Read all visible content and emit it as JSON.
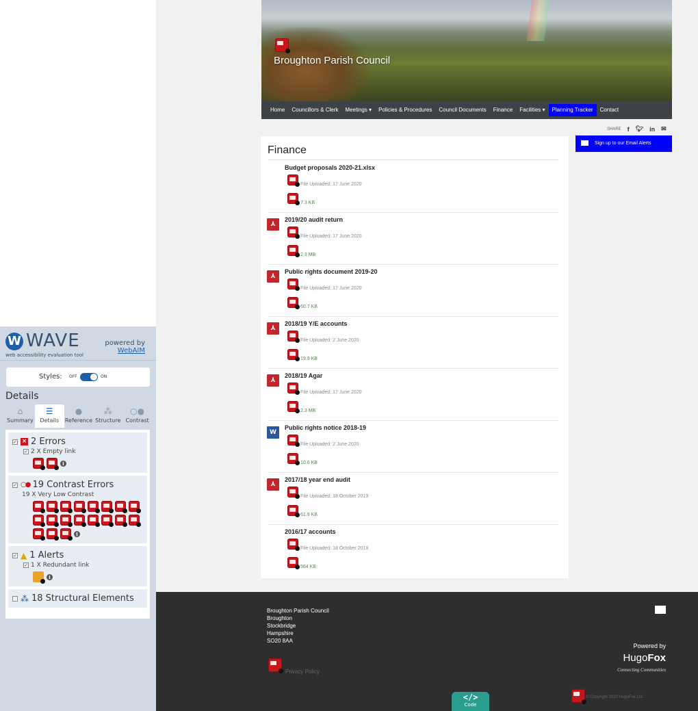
{
  "wave": {
    "logo": "WAVE",
    "logo_mark": "W",
    "tagline": "web accessibility evaluation tool",
    "powered_by": "powered by",
    "powered_link": "WebAIM",
    "styles_label": "Styles:",
    "styles_off": "OFF",
    "styles_on": "ON",
    "panel_title": "Details",
    "tabs": [
      {
        "label": "Summary",
        "icon": "home-icon"
      },
      {
        "label": "Details",
        "icon": "list-icon"
      },
      {
        "label": "Reference",
        "icon": "info-icon"
      },
      {
        "label": "Structure",
        "icon": "structure-icon"
      },
      {
        "label": "Contrast",
        "icon": "contrast-icon"
      }
    ],
    "errors": {
      "title": "2 Errors",
      "sub": "2 X Empty link",
      "count": 2
    },
    "contrast": {
      "title": "19 Contrast Errors",
      "sub": "19 X Very Low Contrast",
      "count": 19
    },
    "alerts": {
      "title": "1 Alerts",
      "sub": "1 X Redundant link",
      "count": 1
    },
    "structural": {
      "title": "18 Structural Elements"
    }
  },
  "site": {
    "title": "Broughton Parish Council",
    "nav": [
      "Home",
      "Councillors & Clerk",
      "Meetings ▾",
      "Policies & Procedures",
      "Council Documents",
      "Finance",
      "Facilities ▾",
      "Planning Tracker",
      "Contact"
    ],
    "share_label": "SHARE",
    "share_icons": [
      "f",
      "t",
      "in",
      "✉"
    ],
    "signup": "Sign up to our Email Alerts",
    "page_title": "Finance",
    "documents": [
      {
        "name": "Budget proposals 2020-21.xlsx",
        "uploaded": "File Uploaded: 17 June 2020",
        "size": "7.3 KB",
        "type": "none"
      },
      {
        "name": "2019/20 audit return",
        "uploaded": "File Uploaded: 17 June 2020",
        "size": "2.3 MB",
        "type": "pdf"
      },
      {
        "name": "Public rights document 2019-20",
        "uploaded": "File Uploaded: 17 June 2020",
        "size": "60.7 KB",
        "type": "pdf"
      },
      {
        "name": "2018/19 Y/E accounts",
        "uploaded": "File Uploaded: 2 June 2020",
        "size": "19.9 KB",
        "type": "pdf"
      },
      {
        "name": "2018/19 Agar",
        "uploaded": "File Uploaded: 17 June 2020",
        "size": "2.3 MB",
        "type": "pdf"
      },
      {
        "name": "Public rights notice 2018-19",
        "uploaded": "File Uploaded: 2 June 2020",
        "size": "10.6 KB",
        "type": "word"
      },
      {
        "name": "2017/18 year end audit",
        "uploaded": "File Uploaded: 18 October 2019",
        "size": "61.9 KB",
        "type": "pdf"
      },
      {
        "name": "2016/17 accounts",
        "uploaded": "File Uploaded: 18 October 2019",
        "size": "564 KB",
        "type": "none"
      }
    ],
    "footer": {
      "address": [
        "Broughton Parish Council",
        "Broughton",
        "Stockbridge",
        "Hampshire",
        "SO20 8AA"
      ],
      "privacy": "Privacy Policy",
      "powered_by": "Powered by",
      "brand_a": "Hugo",
      "brand_b": "Fox",
      "tagline": "Connecting Communities",
      "copyright": "© Copyright 2020 HugoFox Ltd."
    }
  },
  "code_button": {
    "glyph": "</>",
    "label": "Code"
  }
}
